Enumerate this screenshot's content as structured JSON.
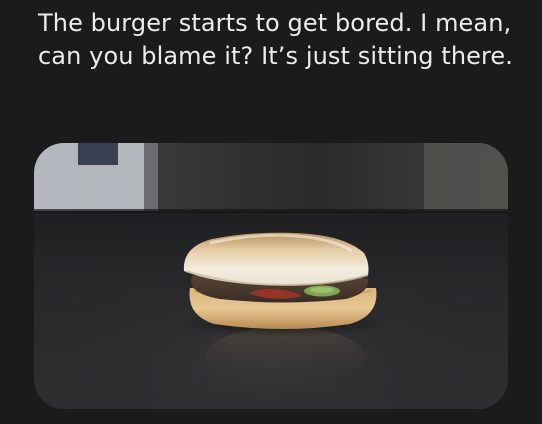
{
  "message": {
    "caption": "The burger starts to get bored. I mean, can you blame it? It’s just sitting there."
  },
  "photo": {
    "subject": "burger",
    "colors": {
      "background": "#1b1b1b",
      "caption_text": "#ececec",
      "table": "#2a2a2c",
      "bun": "#e9d6b8",
      "patty": "#4a3a30"
    }
  }
}
